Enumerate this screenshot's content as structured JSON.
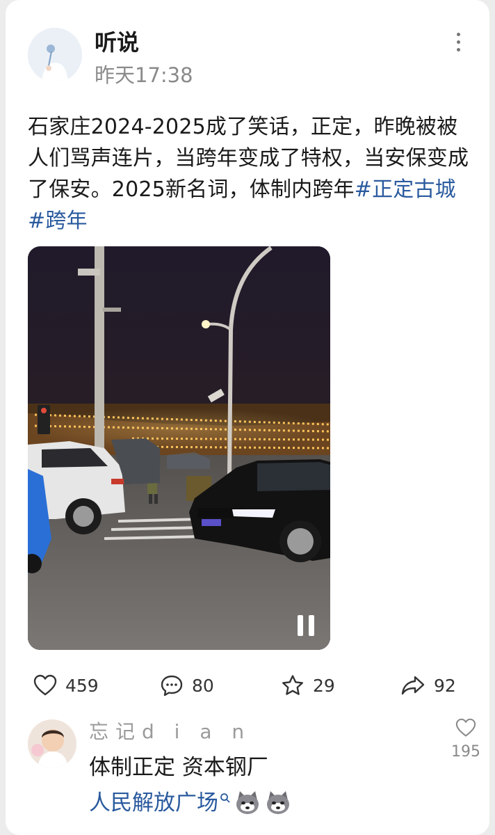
{
  "post": {
    "author": "听说",
    "time": "昨天17:38",
    "text_plain": "石家庄2024-2025成了笑话，正定，昨晚被被人们骂声连片，当跨年变成了特权，当安保变成了保安。2025新名词，体制内跨年",
    "hashtags": [
      "#正定古城",
      "#跨年"
    ],
    "video": {
      "state": "playing",
      "control_icon": "pause-icon"
    }
  },
  "actions": {
    "like": {
      "icon": "heart-icon",
      "count": "459"
    },
    "comment": {
      "icon": "chat-bubble-icon",
      "count": "80"
    },
    "favorite": {
      "icon": "star-icon",
      "count": "29"
    },
    "share": {
      "icon": "share-arrow-icon",
      "count": "92"
    }
  },
  "comment": {
    "author": "忘记d i a n",
    "text": "体制正定 资本钢厂",
    "link_text": "人民解放广场",
    "link_icon": "search-icon",
    "emojis": [
      "husky-emoji",
      "husky-emoji"
    ],
    "like_count": "195"
  },
  "colors": {
    "link": "#2a5a9e",
    "muted": "#8a8a8a",
    "background": "#ececec"
  }
}
